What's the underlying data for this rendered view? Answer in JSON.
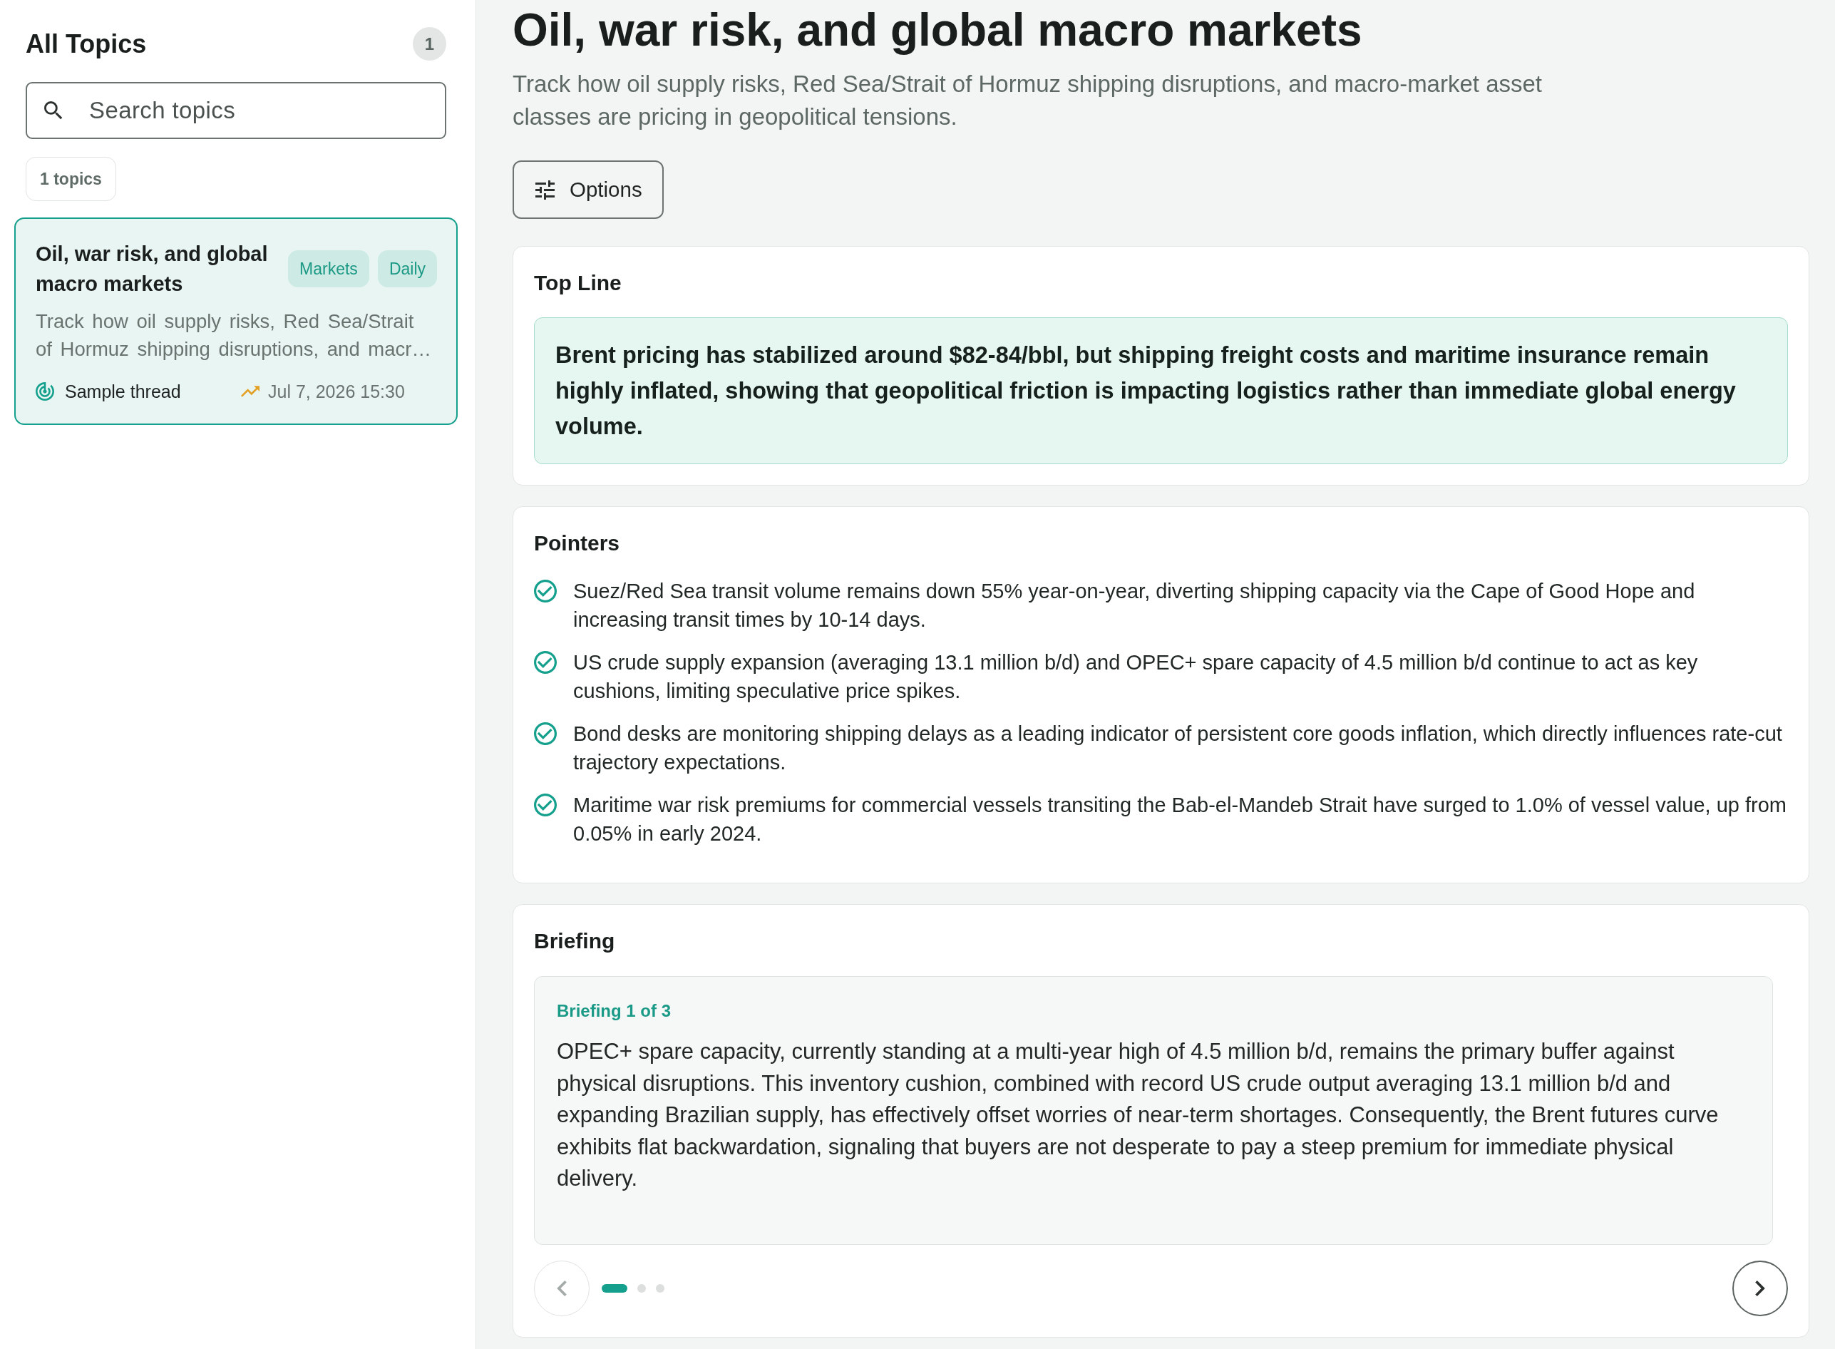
{
  "sidebar": {
    "title": "All Topics",
    "count": "1",
    "search": {
      "placeholder": "Search topics"
    },
    "filter_chip": "1 topics",
    "topics": [
      {
        "title": "Oil, war risk, and global macro markets",
        "tags": [
          "Markets",
          "Daily"
        ],
        "description": "Track how oil supply risks, Red Sea/Strait of Hormuz shipping disruptions, and macr…",
        "thread": "Sample thread",
        "timestamp": "Jul 7, 2026 15:30",
        "selected": true
      }
    ]
  },
  "header": {
    "title": "Oil, war risk, and global macro markets",
    "subtitle": "Track how oil supply risks, Red Sea/Strait of Hormuz shipping disruptions, and macro-market asset classes are pricing in geopolitical tensions.",
    "options_button": "Options"
  },
  "top_line": {
    "heading": "Top Line",
    "summary": "Brent pricing has stabilized around $82-84/bbl, but shipping freight costs and maritime insurance remain highly inflated, showing that geopolitical friction is impacting logistics rather than immediate global energy volume."
  },
  "pointers": {
    "heading": "Pointers",
    "items": [
      "Suez/Red Sea transit volume remains down 55% year-on-year, diverting shipping capacity via the Cape of Good Hope and increasing transit times by 10-14 days.",
      "US crude supply expansion (averaging 13.1 million b/d) and OPEC+ spare capacity of 4.5 million b/d continue to act as key cushions, limiting speculative price spikes.",
      "Bond desks are monitoring shipping delays as a leading indicator of persistent core goods inflation, which directly influences rate-cut trajectory expectations.",
      "Maritime war risk premiums for commercial vessels transiting the Bab-el-Mandeb Strait have surged to 1.0% of vessel value, up from 0.05% in early 2024."
    ]
  },
  "briefing": {
    "heading": "Briefing",
    "counter": "Briefing 1 of 3",
    "text": "OPEC+ spare capacity, currently standing at a multi-year high of 4.5 million b/d, remains the primary buffer against physical disruptions. This inventory cushion, combined with record US crude output averaging 13.1 million b/d and expanding Brazilian supply, has effectively offset worries of near-term shortages. Consequently, the Brent futures curve exhibits flat backwardation, signaling that buyers are not desperate to pay a steep premium for immediate physical delivery.",
    "previous_button": {
      "disabled": true
    },
    "next_button": {
      "disabled": false
    },
    "pages": [
      {
        "selected": true
      },
      {
        "selected": false
      },
      {
        "selected": false
      }
    ]
  }
}
